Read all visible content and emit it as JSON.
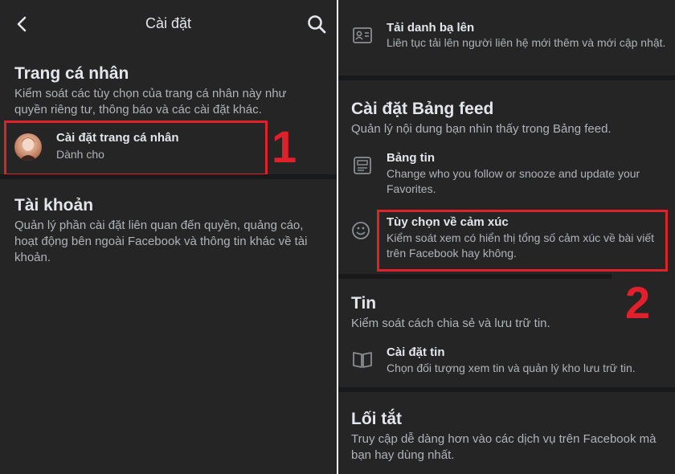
{
  "left": {
    "header": {
      "title": "Cài đặt"
    },
    "profile_section": {
      "title": "Trang cá nhân",
      "description": "Kiểm soát các tùy chọn của trang cá nhân này như quyền riêng tư, thông báo và các cài đặt khác.",
      "item": {
        "title": "Cài đặt trang cá nhân",
        "subtitle": "Dành cho"
      }
    },
    "account_section": {
      "title": "Tài khoản",
      "description": "Quản lý phần cài đặt liên quan đến quyền, quảng cáo, hoạt động bên ngoài Facebook và thông tin khác về tài khoản."
    },
    "marker": "1"
  },
  "right": {
    "contacts_item": {
      "title": "Tải danh bạ lên",
      "subtitle": "Liên tục tải lên người liên hệ mới thêm và mới cập nhật."
    },
    "feed_section": {
      "title": "Cài đặt Bảng feed",
      "description": "Quản lý nội dung bạn nhìn thấy trong Bảng feed.",
      "items": [
        {
          "title": "Bảng tin",
          "subtitle": "Change who you follow or snooze and update your Favorites."
        },
        {
          "title": "Tùy chọn về cảm xúc",
          "subtitle": "Kiểm soát xem có hiển thị tổng số cảm xúc về bài viết trên Facebook hay không."
        }
      ]
    },
    "stories_section": {
      "title": "Tin",
      "description": "Kiểm soát cách chia sẻ và lưu trữ tin.",
      "item": {
        "title": "Cài đặt tin",
        "subtitle": "Chọn đối tượng xem tin và quản lý kho lưu trữ tin."
      }
    },
    "shortcuts_section": {
      "title": "Lối tắt",
      "description": "Truy cập dễ dàng hơn vào các dịch vụ trên Facebook mà bạn hay dùng nhất."
    },
    "marker": "2"
  },
  "colors": {
    "highlight": "#e0202a",
    "background": "#252526",
    "separator": "#18191a"
  },
  "icons": [
    "back-arrow-icon",
    "search-icon",
    "contacts-icon",
    "news-feed-icon",
    "reactions-icon",
    "story-book-icon"
  ]
}
